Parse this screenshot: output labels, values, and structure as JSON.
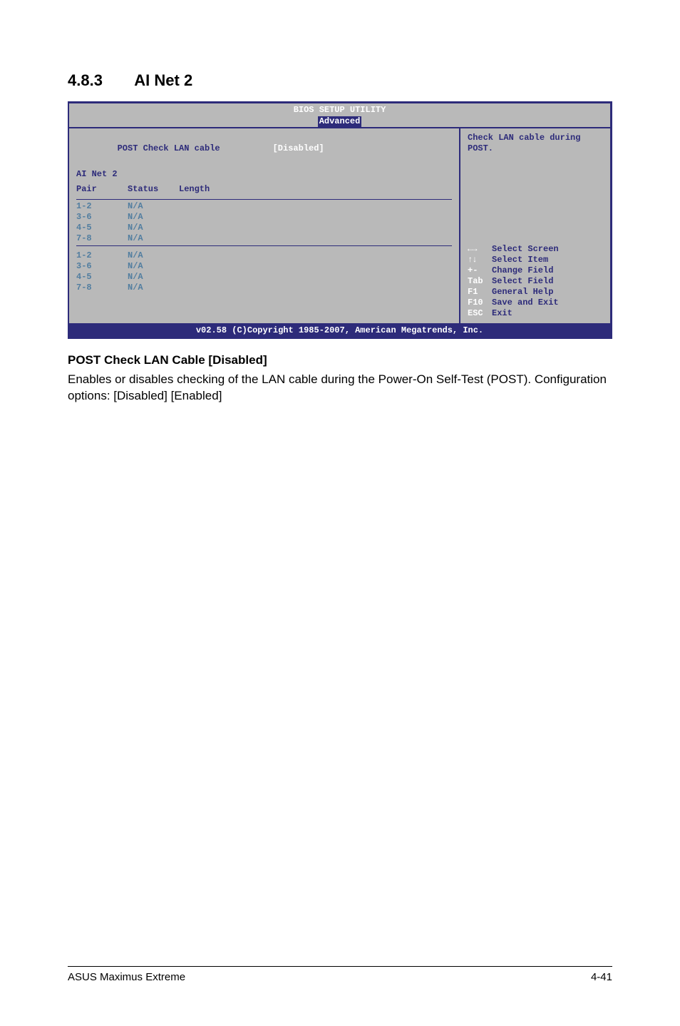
{
  "section": {
    "number": "4.8.3",
    "title": "AI Net 2"
  },
  "bios": {
    "title": "BIOS SETUP UTILITY",
    "tab": "Advanced",
    "setting": {
      "label": "POST Check LAN cable",
      "value": "[Disabled]"
    },
    "subtitle": "AI Net 2",
    "columns": {
      "pair": "Pair",
      "status": "Status",
      "length": "Length"
    },
    "group1": [
      {
        "pair": "1-2",
        "status": "N/A",
        "length": ""
      },
      {
        "pair": "3-6",
        "status": "N/A",
        "length": ""
      },
      {
        "pair": "4-5",
        "status": "N/A",
        "length": ""
      },
      {
        "pair": "7-8",
        "status": "N/A",
        "length": ""
      }
    ],
    "group2": [
      {
        "pair": "1-2",
        "status": "N/A",
        "length": ""
      },
      {
        "pair": "3-6",
        "status": "N/A",
        "length": ""
      },
      {
        "pair": "4-5",
        "status": "N/A",
        "length": ""
      },
      {
        "pair": "7-8",
        "status": "N/A",
        "length": ""
      }
    ],
    "help": "Check LAN cable during POST.",
    "keys": {
      "lr": "←→",
      "lr_desc": "Select Screen",
      "ud": "↑↓",
      "ud_desc": "Select Item",
      "pm": "+-",
      "pm_desc": "Change Field",
      "tab": "Tab",
      "tab_desc": "Select Field",
      "f1": "F1",
      "f1_desc": "General Help",
      "f10": "F10",
      "f10_desc": "Save and Exit",
      "esc": "ESC",
      "esc_desc": "Exit"
    },
    "footer": "v02.58 (C)Copyright 1985-2007, American Megatrends, Inc."
  },
  "description": {
    "subheading": "POST Check LAN Cable  [Disabled]",
    "text": "Enables or disables checking of the LAN cable during the Power-On Self-Test (POST). Configuration options: [Disabled] [Enabled]"
  },
  "footer": {
    "left": "ASUS Maximus Extreme",
    "right": "4-41"
  }
}
